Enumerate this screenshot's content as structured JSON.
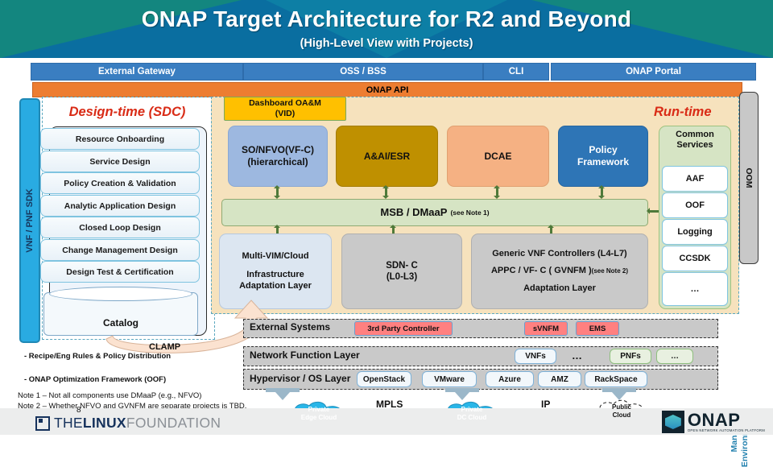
{
  "banner": {
    "title": "ONAP Target Architecture for R2 and Beyond",
    "subtitle": "(High-Level View with Projects)"
  },
  "top_bars": {
    "external_gateway": "External Gateway",
    "oss_bss": "OSS / BSS",
    "cli": "CLI",
    "onap_portal": "ONAP Portal",
    "onap_api": "ONAP API"
  },
  "left_rail": {
    "label": "VNF / PNF SDK"
  },
  "right_rail": {
    "label": "OOM"
  },
  "managed_environment": {
    "line1": "Managed",
    "line2": "Environment"
  },
  "design_time": {
    "title": "Design-time (SDC)",
    "items": [
      "Resource Onboarding",
      "Service  Design",
      "Policy Creation & Validation",
      "Analytic Application Design",
      "Closed Loop Design",
      "Change Management Design",
      "Design Test & Certification"
    ],
    "catalog": "Catalog"
  },
  "run_time": {
    "title": "Run-time",
    "vid": {
      "line1": "Dashboard OA&M",
      "line2": "(VID)"
    },
    "so": {
      "line1": "SO/NFVO(VF-C)",
      "line2": "(hierarchical)"
    },
    "aai": "A&AI/ESR",
    "dcae": "DCAE",
    "policy": {
      "line1": "Policy",
      "line2": "Framework"
    },
    "msb": {
      "label": "MSB / DMaaP",
      "note": "(see Note 1)"
    },
    "multivim": {
      "line1": "Multi-VIM/Cloud",
      "line2": "Infrastructure",
      "line3": "Adaptation Layer"
    },
    "sdnc": {
      "line1": "SDN- C",
      "line2": "(L0-L3)"
    },
    "gvnf": {
      "line1": "Generic VNF Controllers  (L4-L7)",
      "line2": "APPC / VF- C ( GVNFM )",
      "line2_note": "(see Note 2)",
      "line3": "Adaptation Layer"
    },
    "common_services": {
      "title_line1": "Common",
      "title_line2": "Services",
      "items": [
        "AAF",
        "OOF",
        "Logging",
        "CCSDK",
        "…"
      ]
    }
  },
  "bottom": {
    "external_systems": {
      "label": "External Systems",
      "boxes": [
        "3rd Party Controller",
        "sVNFM",
        "EMS"
      ],
      "third_party_sup": "rd"
    },
    "network_function_layer": {
      "label": "Network Function Layer",
      "vnfs": "VNFs",
      "dots_mid": "…",
      "pnfs": "PNFs",
      "dots_end": "…"
    },
    "hypervisor_layer": {
      "label": "Hypervisor / OS Layer",
      "boxes": [
        "OpenStack",
        "VMware",
        "Azure",
        "AMZ",
        "RackSpace"
      ]
    },
    "clouds": [
      {
        "line1": "Private",
        "line2": "Edge Cloud"
      },
      {
        "line1": "Private",
        "line2": "DC Cloud"
      },
      {
        "line1": "Public",
        "line2": "Cloud"
      }
    ],
    "links": [
      "MPLS",
      "IP"
    ]
  },
  "clamp": {
    "label": "CLAMP"
  },
  "notes": {
    "bullet1": "-   Recipe/Eng Rules & Policy Distribution",
    "bullet2": "-    ONAP Optimization Framework (OOF)",
    "note1": "Note 1 – Not all components use DMaaP (e.g., NFVO)",
    "note2": "Note 2 – Whether NFVO and GVNFM are separate projects is TBD."
  },
  "footer": {
    "page_number": "8",
    "linux_foundation": {
      "the": "THE",
      "linux": "LINUX",
      "foundation": "FOUNDATION"
    },
    "onap": {
      "name": "ONAP",
      "tagline": "OPEN NETWORK AUTOMATION PLATFORM"
    }
  },
  "colors": {
    "banner": "#0a6ea0",
    "header_bar": "#3a7ec1",
    "api_bar": "#ed7d31",
    "runtime_bg": "#f6e2bd",
    "accent_red": "#d92b16",
    "sdk_bar": "#29abe2"
  }
}
